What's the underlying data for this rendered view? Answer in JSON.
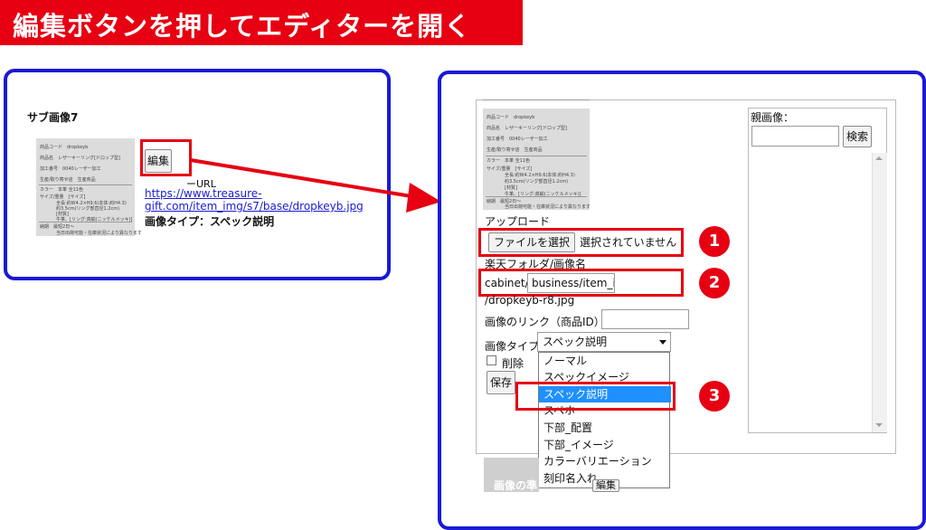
{
  "banner": {
    "title": "編集ボタンを押してエディターを開く"
  },
  "left_panel": {
    "heading": "サブ画像7",
    "edit_button": "編集",
    "url_label_partial": "ーURL",
    "url_line1": "https://www.treasure-",
    "url_line2": "gift.com/item_img/s7/base/dropkeyb.jpg",
    "image_type_line": "画像タイプ：スペック説明"
  },
  "thumbnail": {
    "lines": [
      "商品コード　dropkeyb",
      "商品名　レザーキーリング[ドロップ型]",
      "加工番号　0040レーザー加工",
      "生産/取り寄せ店　生産商品",
      "カラー　本革 全11色",
      "サイズ/重量　[サイズ]",
      "全長:約W4.2×H9.6(本体:約H4.3)",
      "約3.5cm(リング部直径1.2cm)",
      "[材質]",
      "牛革、[リング:真鍮(ニッケルメッキ)]",
      "納期　最短2日〜",
      "当日出荷可能・在庫状況により異なります"
    ]
  },
  "editor": {
    "parent_image_label": "親画像：",
    "search_button": "検索",
    "upload_label": "アップロード",
    "file_button": "ファイルを選択",
    "file_status": "選択されていません",
    "folder_label": "楽天フォルダ/画像名",
    "cabinet_prefix": "cabinet/",
    "folder_input_value": "business/item_im",
    "filename_suffix": "/dropkeyb-r8.jpg",
    "link_label": "画像のリンク（商品ID）",
    "image_type_label": "画像タイプ",
    "image_type_selected": "スペック説明",
    "delete_label": "削除",
    "save_button": "保存",
    "partial_footer_text": "画像の準",
    "partial_footer_button": "編集",
    "dropdown_options": [
      "ノーマル",
      "スペックイメージ",
      "スペック説明",
      "スペホ",
      "下部_配置",
      "下部_イメージ",
      "カラーバリエーション",
      "刻印名入れ"
    ],
    "dropdown_highlighted_index": 2
  },
  "callouts": [
    "1",
    "2",
    "3"
  ],
  "colors": {
    "accent_red": "#e60012",
    "panel_blue": "#1a1ad6",
    "option_highlight": "#1e90ff"
  }
}
